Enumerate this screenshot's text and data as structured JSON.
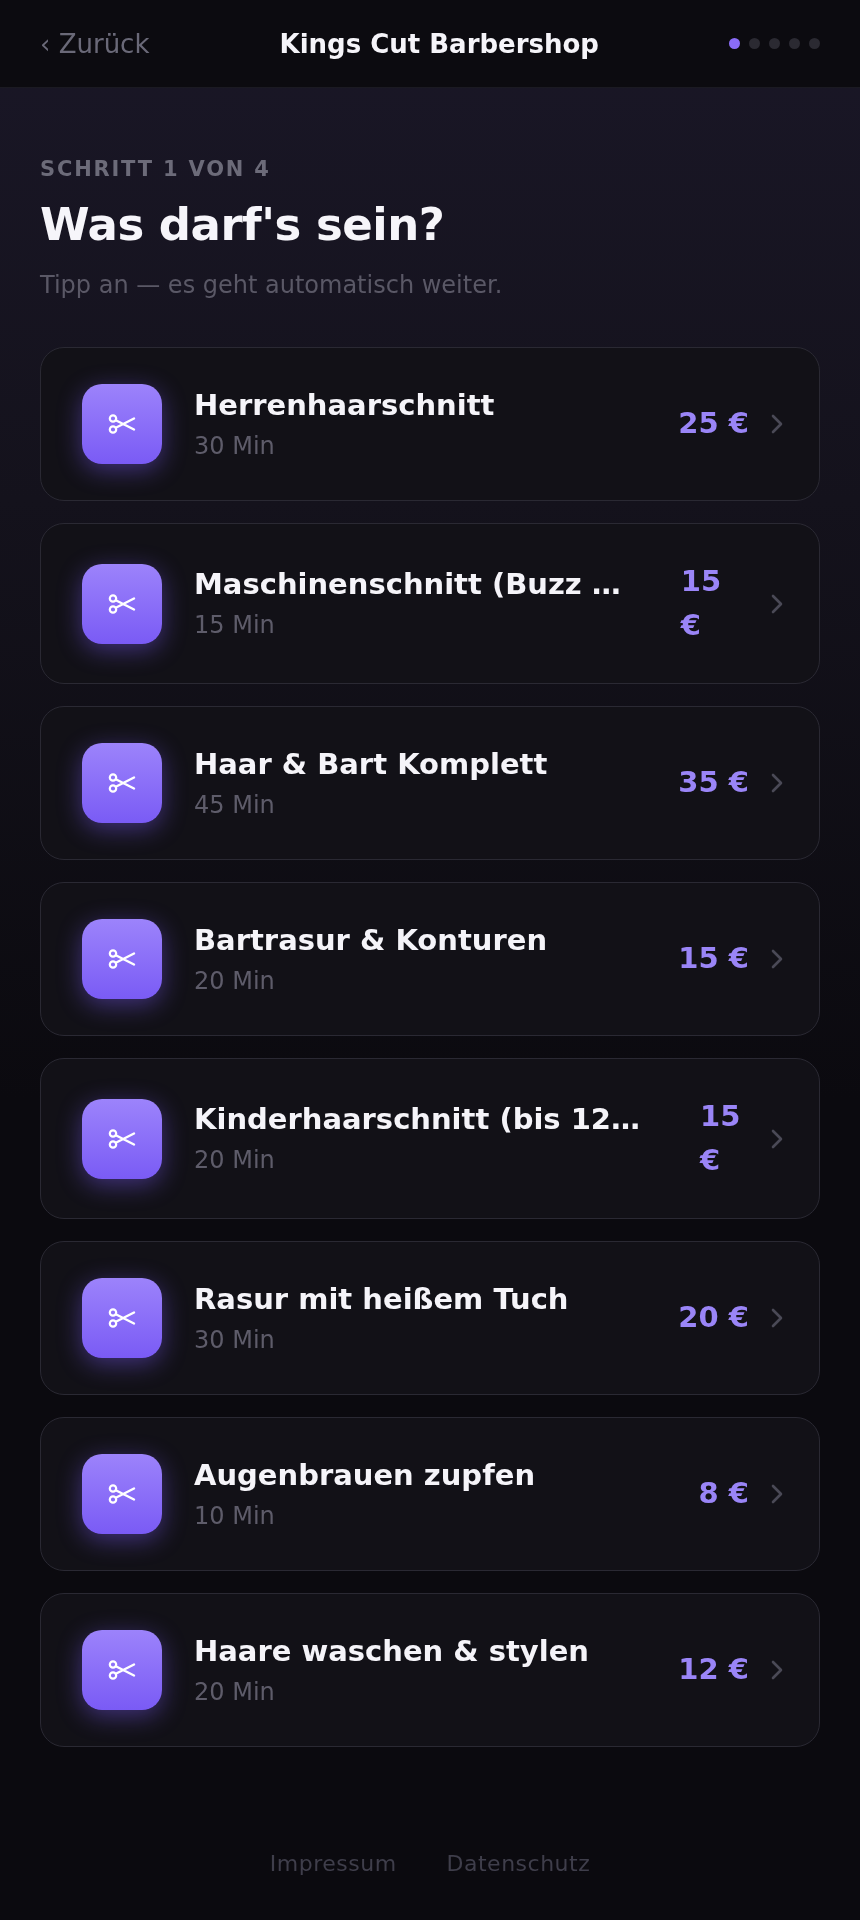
{
  "header": {
    "back_label": "‹ Zurück",
    "title": "Kings Cut Barbershop",
    "steps": [
      {
        "active": true
      },
      {
        "active": false
      },
      {
        "active": false
      },
      {
        "active": false
      },
      {
        "active": false
      }
    ]
  },
  "intro": {
    "step_label": "SCHRITT 1 VON 4",
    "heading": "Was darf's sein?",
    "subtitle": "Tipp an — es geht automatisch weiter."
  },
  "services": [
    {
      "name": "Herrenhaarschnitt",
      "duration": "30 Min",
      "price": "25 €",
      "selected": false
    },
    {
      "name": "Maschinenschnitt (Buzz …",
      "duration": "15 Min",
      "price": "15 €",
      "selected": false
    },
    {
      "name": "Haar & Bart Komplett",
      "duration": "45 Min",
      "price": "35 €",
      "selected": false
    },
    {
      "name": "Bartrasur & Konturen",
      "duration": "20 Min",
      "price": "15 €",
      "selected": false
    },
    {
      "name": "Kinderhaarschnitt (bis 12…",
      "duration": "20 Min",
      "price": "15 €",
      "selected": false
    },
    {
      "name": "Rasur mit heißem Tuch",
      "duration": "30 Min",
      "price": "20 €",
      "selected": false
    },
    {
      "name": "Augenbrauen zupfen",
      "duration": "10 Min",
      "price": "8 €",
      "selected": false
    },
    {
      "name": "Haare waschen & stylen",
      "duration": "20 Min",
      "price": "12 €",
      "selected": false
    }
  ],
  "footer": {
    "links": [
      "Impressum",
      "Datenschutz"
    ]
  }
}
